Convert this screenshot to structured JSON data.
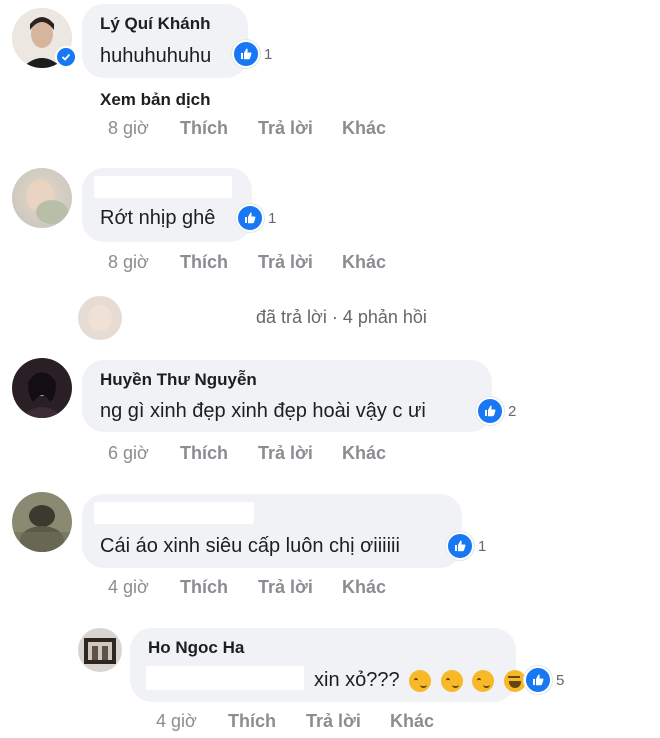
{
  "comments": [
    {
      "author": "Lý Quí Khánh",
      "text": "huhuhuhuhu",
      "likes": "1",
      "see_translation": "Xem bản dịch",
      "time": "8 giờ",
      "like_label": "Thích",
      "reply_label": "Trả lời",
      "more_label": "Khác",
      "verified": true
    },
    {
      "author": "",
      "text": "Rớt nhịp ghê",
      "likes": "1",
      "time": "8 giờ",
      "like_label": "Thích",
      "reply_label": "Trả lời",
      "more_label": "Khác"
    },
    {
      "reply_summary": "đã trả lời · 4 phản hồi"
    },
    {
      "author": "Huyền Thư Nguyễn",
      "text": "ng gì xinh đẹp xinh đẹp hoài vậy c ưi",
      "likes": "2",
      "time": "6 giờ",
      "like_label": "Thích",
      "reply_label": "Trả lời",
      "more_label": "Khác"
    },
    {
      "author": "",
      "text": "Cái áo xinh siêu cấp luôn chị ơiiiiii",
      "likes": "1",
      "time": "4 giờ",
      "like_label": "Thích",
      "reply_label": "Trả lời",
      "more_label": "Khác"
    },
    {
      "author": "Ho Ngoc Ha",
      "text": "xin xỏ???",
      "likes": "5",
      "time": "4 giờ",
      "like_label": "Thích",
      "reply_label": "Trả lời",
      "more_label": "Khác"
    }
  ],
  "colors": {
    "bubble": "#f0f2f5",
    "like_blue": "#1877f2",
    "meta_gray": "#8a8d91"
  },
  "icons": {
    "like": "thumbs-up-icon",
    "verified": "verified-badge-icon",
    "emoji": "smirk-emoji-icon",
    "haha": "laughing-emoji-icon"
  }
}
